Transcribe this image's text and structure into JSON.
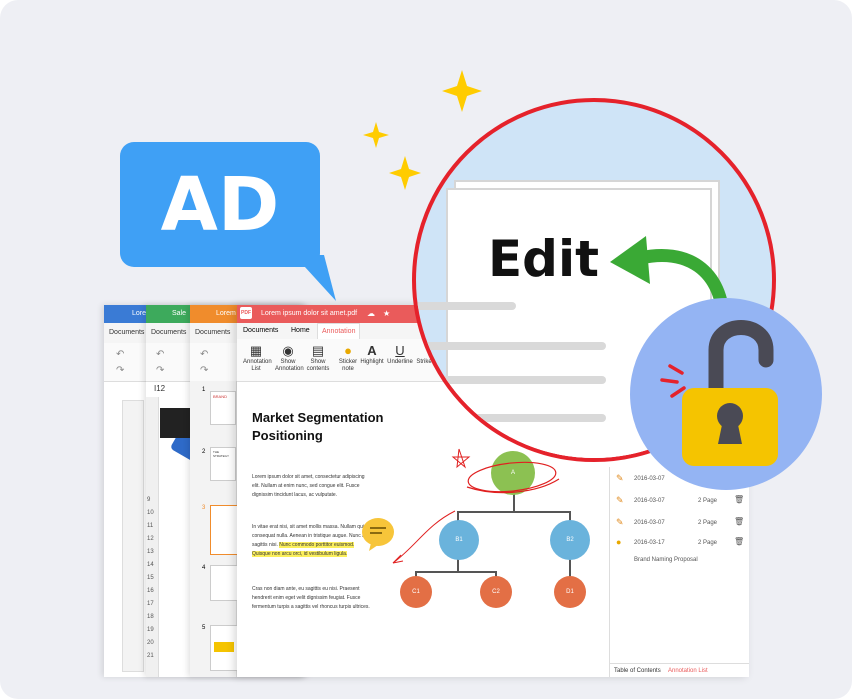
{
  "ad_bubble": {
    "text": "AD"
  },
  "layers": {
    "doc1_title": "Lorem",
    "doc2_title": "Sale",
    "doc3_title": "Lorem",
    "menu_documents": "Documents",
    "cell_ref": "I12",
    "row_numbers": [
      "9",
      "10",
      "11",
      "12",
      "13",
      "14",
      "15",
      "16",
      "17",
      "18",
      "19",
      "20",
      "21"
    ],
    "slide_numbers": [
      "1",
      "2",
      "3",
      "4",
      "5"
    ],
    "slide_labels": [
      "BRAND",
      "THE STRATEGY"
    ]
  },
  "pdf_window": {
    "tab_title": "Lorem ipsum dolor sit amet.pdf",
    "tab_badge": "PDF",
    "menu": [
      "Documents",
      "Home",
      "Annotation"
    ],
    "tools": [
      {
        "icon": "annotation-list-icon",
        "label": "Annotation List"
      },
      {
        "icon": "eye-icon",
        "label": "Show Annotation"
      },
      {
        "icon": "contents-icon",
        "label": "Show contents"
      },
      {
        "icon": "sticker-note-icon",
        "label": "Sticker note"
      },
      {
        "icon": "highlight-icon",
        "label": "Highlight"
      },
      {
        "icon": "underline-icon",
        "label": "Underline"
      },
      {
        "icon": "strikethrough-icon",
        "label": "Strike"
      }
    ],
    "doc_title": "Market Segmentation Positioning",
    "para1": "Lorem ipsum dolor sit amet, consectetur adipiscing elit. Nullam at enim nunc, sed congue elit. Fusce dignissim tincidunt lacus, ac vulputate.",
    "para2a": "In vitae erat nisi, sit amet mollis massa. Nullam quis consequat nulla. Aenean in tristique augue. Nunc at sagittis nisi.",
    "para2b": "Nunc commodo porttitor euismod. Quisque non arcu orci, id vestibulum ligula.",
    "para3": "Cras non diam ante, eu sagittis eu nisi. Praesent hendrerit enim eget velit dignissim feugiat. Fusce fermentum turpis a sagittis vel rhoncus turpis ultrices.",
    "chart_nodes": {
      "a": "A",
      "b1": "B1",
      "b2": "B2",
      "c1": "C1",
      "c2": "C2",
      "d1": "D1"
    }
  },
  "annotation_panel": {
    "rows": [
      {
        "icon": "pencil-icon",
        "date": "2016-03-07",
        "page": ""
      },
      {
        "icon": "pencil-icon",
        "date": "2016-03-07",
        "page": "2 Page"
      },
      {
        "icon": "pencil-icon",
        "date": "2016-03-07",
        "page": "2 Page"
      },
      {
        "icon": "sticker-note-icon",
        "date": "2016-03-17",
        "page": "2 Page"
      }
    ],
    "note": "Brand Naming Proposal",
    "tabs": [
      "Table of Contents",
      "Annotation List"
    ]
  },
  "zoom": {
    "edit_label": "Edit"
  },
  "colors": {
    "background": "#eeeff4",
    "ad_blue": "#3fa0f5",
    "sparkle": "#ffcc00",
    "ring_red": "#e5222b",
    "arrow_green": "#3aa935",
    "lock_bg": "#94b4f3",
    "lock_body": "#f5c400",
    "pdf_red": "#ea5b5b",
    "word_blue": "#3a7bd5",
    "sheet_green": "#3daa5c",
    "slide_orange": "#f08c2c"
  }
}
